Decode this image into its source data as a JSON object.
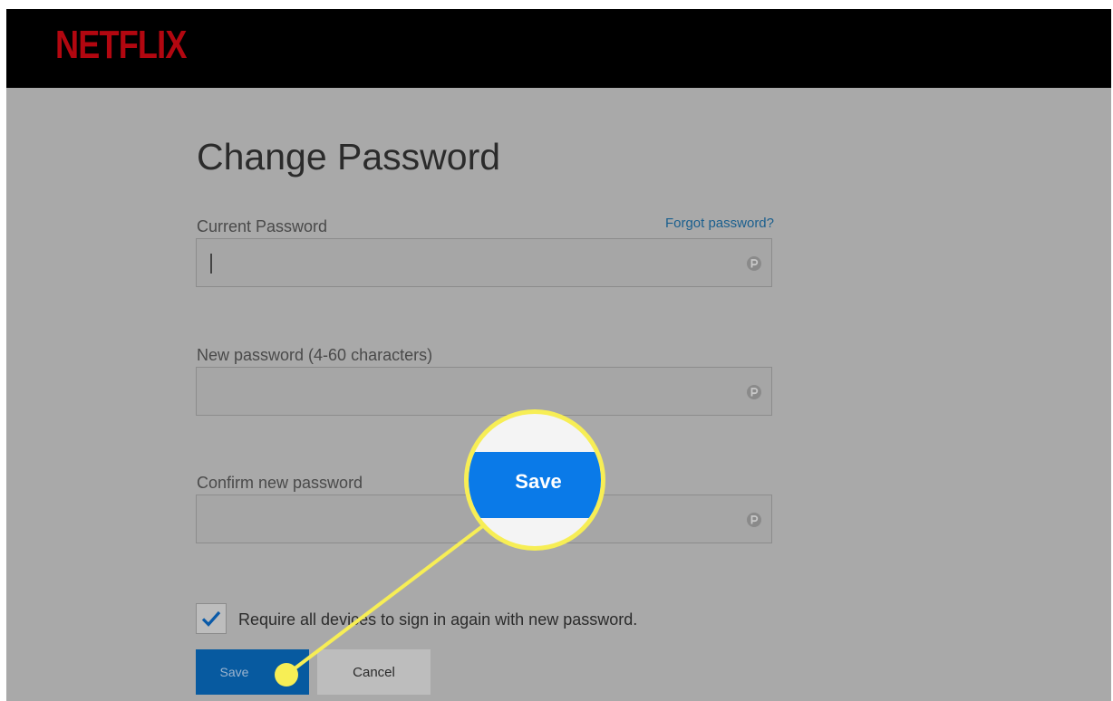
{
  "header": {
    "logo_text": "NETFLIX",
    "logo_color": "#b20710"
  },
  "form": {
    "title": "Change Password",
    "forgot_link": "Forgot password?",
    "fields": [
      {
        "label": "Current Password",
        "value": "",
        "icon": "password-manager-icon"
      },
      {
        "label": "New password (4-60 characters)",
        "value": "",
        "icon": "password-manager-icon"
      },
      {
        "label": "Confirm new password",
        "value": "",
        "icon": "password-manager-icon"
      }
    ],
    "checkbox": {
      "label": "Require all devices to sign in again with new password.",
      "checked": true
    },
    "save_label": "Save",
    "cancel_label": "Cancel"
  },
  "callout": {
    "zoom_label": "Save",
    "highlight_color": "#f7ee55",
    "button_color": "#0a7ae8"
  }
}
